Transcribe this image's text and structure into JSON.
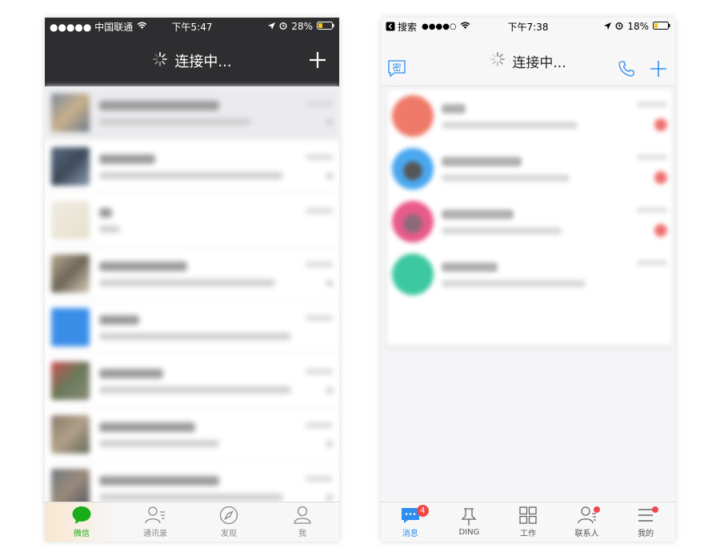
{
  "wechat": {
    "status": {
      "carrier": "●●●●● 中国联通",
      "time": "下午5:47",
      "battery": "28%"
    },
    "header": {
      "title": "连接中..."
    },
    "tabs": [
      {
        "label": "微信",
        "icon": "chat-bubble-icon"
      },
      {
        "label": "通讯录",
        "icon": "contacts-icon"
      },
      {
        "label": "发现",
        "icon": "compass-icon"
      },
      {
        "label": "我",
        "icon": "person-icon"
      }
    ],
    "colors": {
      "header": "#2e2e30",
      "active": "#1aad19"
    }
  },
  "dingtalk": {
    "status": {
      "back": "搜索",
      "signal": "●●●●○",
      "time": "下午7:38",
      "battery": "18%"
    },
    "header": {
      "title": "连接中...",
      "secret_label": "密"
    },
    "tabs": [
      {
        "label": "消息",
        "icon": "message-icon",
        "badge": "4"
      },
      {
        "label": "DING",
        "icon": "pin-icon"
      },
      {
        "label": "工作",
        "icon": "grid-icon"
      },
      {
        "label": "联系人",
        "icon": "contacts-icon"
      },
      {
        "label": "我的",
        "icon": "menu-icon"
      }
    ],
    "colors": {
      "accent": "#2d8ef0",
      "badge": "#f04848"
    }
  }
}
